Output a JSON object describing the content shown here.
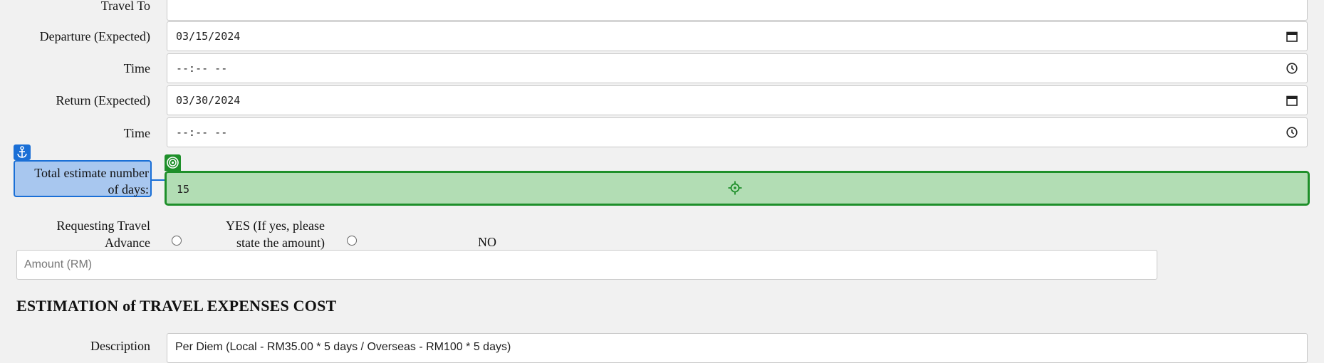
{
  "form": {
    "travel_to": {
      "label": "Travel To",
      "value": ""
    },
    "departure": {
      "label": "Departure (Expected)",
      "value": "03/15/2024"
    },
    "departure_time": {
      "label": "Time",
      "value": "--:-- --"
    },
    "return": {
      "label": "Return (Expected)",
      "value": "03/30/2024"
    },
    "return_time": {
      "label": "Time",
      "value": "--:-- --"
    },
    "days": {
      "label_line1": "Total estimate number",
      "label_line2": "of days:",
      "value": "15"
    },
    "advance": {
      "label_line1": "Requesting Travel",
      "label_line2": "Advance",
      "yes_line1": "YES (If yes, please",
      "yes_line2": "state the amount)",
      "no": "NO"
    },
    "amount": {
      "placeholder": "Amount (RM)",
      "value": ""
    }
  },
  "expenses": {
    "title": "ESTIMATION of TRAVEL EXPENSES COST",
    "description_label": "Description",
    "description_value": "Per Diem (Local - RM35.00 * 5 days / Overseas - RM100 * 5 days)"
  },
  "overlay": {
    "anchor_color": "#1a6fd6",
    "target_color": "#1e8f2a",
    "anchor_icon": "anchor-icon",
    "target_icon": "target-icon",
    "crosshair_icon": "crosshair-icon"
  }
}
